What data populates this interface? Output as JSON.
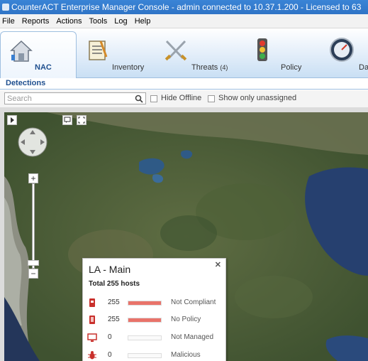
{
  "window": {
    "title": "CounterACT Enterprise Manager Console - admin connected to 10.37.1.200 - Licensed to 63"
  },
  "menu": [
    {
      "label": "File"
    },
    {
      "label": "Reports"
    },
    {
      "label": "Actions"
    },
    {
      "label": "Tools"
    },
    {
      "label": "Log"
    },
    {
      "label": "Help"
    }
  ],
  "tabs": [
    {
      "label": "NAC",
      "icon": "house-icon",
      "active": true
    },
    {
      "label": "Inventory",
      "icon": "clipboard-icon",
      "active": false
    },
    {
      "label": "Threats",
      "count": "(4)",
      "icon": "crossed-swords-icon",
      "active": false
    },
    {
      "label": "Policy",
      "icon": "traffic-light-icon",
      "active": false
    },
    {
      "label": "Da",
      "icon": "gauge-icon",
      "active": false
    }
  ],
  "detections": {
    "header": "Detections",
    "search_placeholder": "Search",
    "hide_offline_label": "Hide Offline",
    "show_unassigned_label": "Show only unassigned"
  },
  "popup": {
    "title": "LA - Main",
    "total": "Total 255 hosts",
    "rows": [
      {
        "count": "255",
        "fill": 1.0,
        "status": "Not Compliant",
        "icon": "broken-device-icon",
        "color": "#e9736a"
      },
      {
        "count": "255",
        "fill": 1.0,
        "status": "No Policy",
        "icon": "device-icon",
        "color": "#e9736a"
      },
      {
        "count": "0",
        "fill": 0.0,
        "status": "Not Managed",
        "icon": "monitor-icon",
        "color": "#e9736a"
      },
      {
        "count": "0",
        "fill": 0.0,
        "status": "Malicious",
        "icon": "bug-icon",
        "color": "#e9736a"
      }
    ]
  }
}
